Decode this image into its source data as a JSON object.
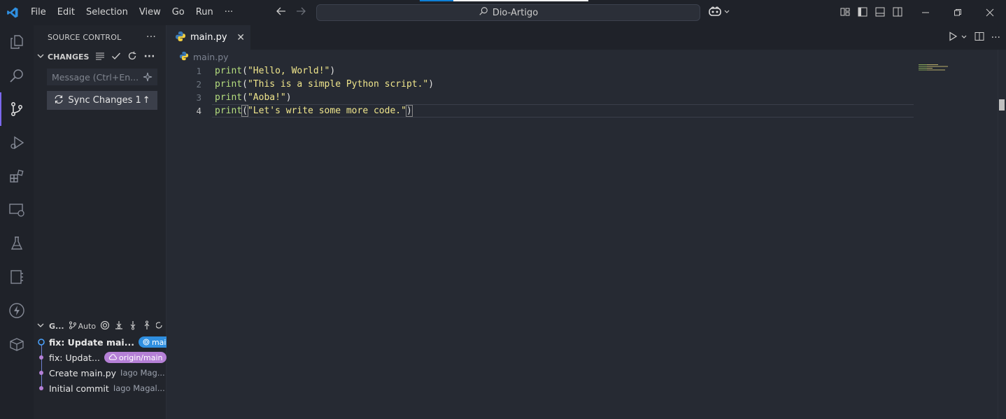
{
  "menu": [
    "File",
    "Edit",
    "Selection",
    "View",
    "Go",
    "Run",
    "···"
  ],
  "command_center": {
    "text": "Dio-Artigo"
  },
  "sidebar": {
    "title": "SOURCE CONTROL",
    "more": "···",
    "changes_label": "CHANGES",
    "message_placeholder": "Message (Ctrl+En...",
    "sync_button": "Sync Changes 1",
    "sync_arrow": "↑"
  },
  "graph": {
    "label": "G...",
    "auto": "Auto",
    "commits": [
      {
        "title": "fix: Update mai...",
        "badge": "main",
        "badge_color": "#2f8fe0",
        "bold": true
      },
      {
        "title": "fix: Updat...",
        "badge": "origin/main",
        "badge_color": "#b580d6",
        "bold": false
      },
      {
        "title": "Create main.py",
        "author": "Iago Mag...",
        "bold": false
      },
      {
        "title": "Initial commit",
        "author": "Iago Magal...",
        "bold": false
      }
    ]
  },
  "editor": {
    "tab_label": "main.py",
    "breadcrumb": "main.py",
    "lines": [
      {
        "num": "1",
        "fn": "print",
        "open": "(",
        "str": "\"Hello, World!\"",
        "close": ")"
      },
      {
        "num": "2",
        "fn": "print",
        "open": "(",
        "str": "\"This is a simple Python script.\"",
        "close": ")"
      },
      {
        "num": "3",
        "fn": "print",
        "open": "(",
        "str": "\"Aoba!\"",
        "close": ")"
      },
      {
        "num": "4",
        "fn": "print",
        "open": "(",
        "str": "\"Let's write some more code.\"",
        "close": ")"
      }
    ],
    "current_line": 4
  },
  "colors": {
    "accent": "#7b68ee",
    "function": "#b5de7f",
    "string": "#f0e68c",
    "badge_blue": "#2f8fe0",
    "badge_purple": "#b580d6"
  }
}
